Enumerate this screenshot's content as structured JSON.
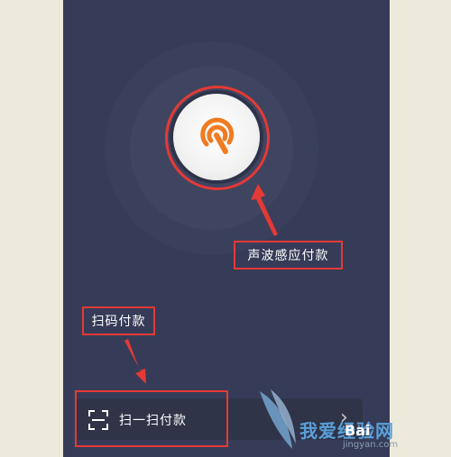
{
  "sonic": {
    "label": "声波感应付款",
    "progress_color": "#1a73e8",
    "icon_color": "#f07b20"
  },
  "qr_pay": {
    "label": "扫码付款"
  },
  "scan_bar": {
    "label": "扫一扫付款"
  },
  "watermark": {
    "brand": "我爱经验网",
    "baidu": "Bai",
    "sub": "jingyan.com"
  },
  "annotation_color": "#e53935"
}
